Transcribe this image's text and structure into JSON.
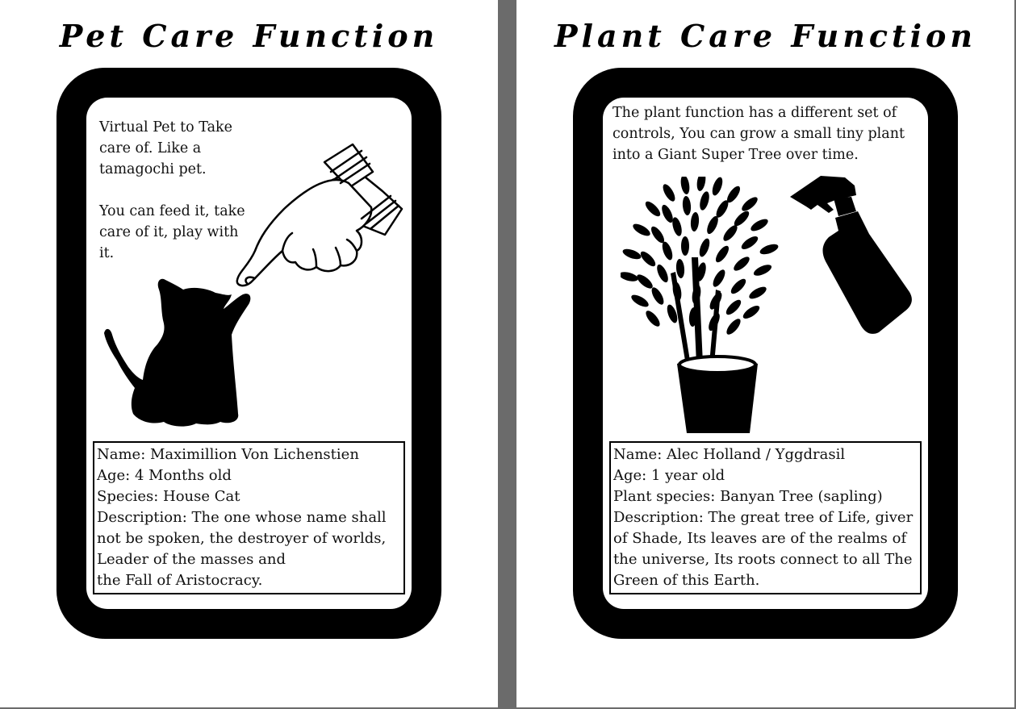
{
  "pet_card": {
    "title": "Pet Care Function",
    "intro_1": "Virtual Pet to Take care of. Like a tamagochi pet.",
    "intro_2": "You can feed it, take care of it, play with it.",
    "info": {
      "name": "Name: Maximillion Von Lichenstien",
      "age": "Age: 4 Months old",
      "species": "Species: House Cat",
      "description": "Description: The one whose name shall not be spoken, the destroyer of worlds, Leader of the masses and",
      "description_2": "the Fall of Aristocracy."
    }
  },
  "plant_card": {
    "title": "Plant Care Function",
    "intro": "The plant function has a different set of controls, You can grow a small tiny plant into a Giant Super Tree over time.",
    "info": {
      "name": "Name: Alec Holland / Yggdrasil",
      "age": "Age: 1 year old",
      "species": "Plant species: Banyan Tree (sapling)",
      "description": "Description: The great tree of Life, giver of Shade, Its leaves are of the realms of the universe, Its roots connect to all The Green of this Earth."
    }
  },
  "icons": {
    "hand": "pointing-hand-icon",
    "cat": "cat-silhouette-icon",
    "plant": "potted-plant-icon",
    "spray": "spray-bottle-icon"
  },
  "colors": {
    "frame": "#000000",
    "page": "#ffffff",
    "gutter": "#6b6b6b"
  }
}
